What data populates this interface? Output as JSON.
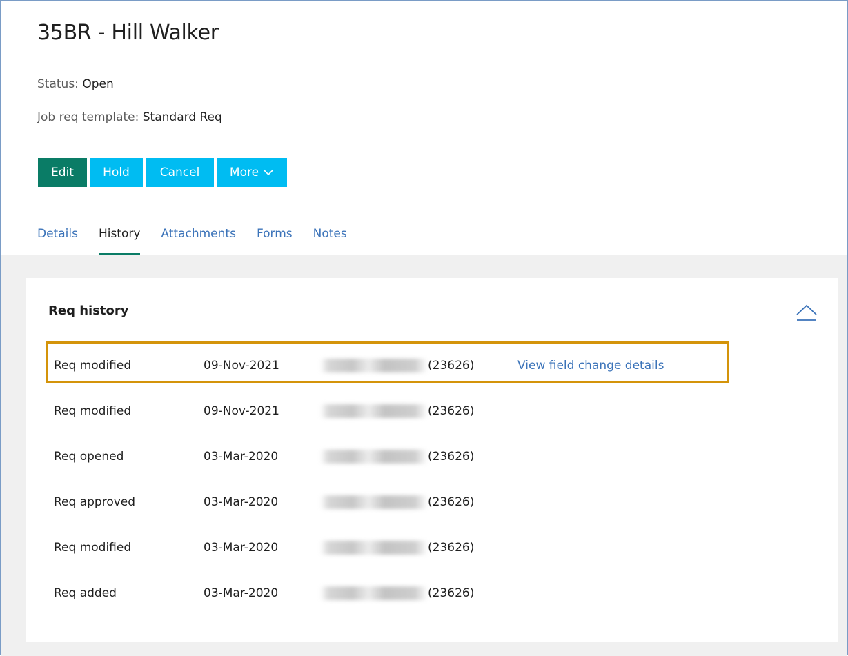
{
  "page": {
    "title": "35BR - Hill Walker",
    "status_label": "Status:",
    "status_value": "Open",
    "template_label": "Job req template:",
    "template_value": "Standard Req"
  },
  "toolbar": {
    "edit_label": "Edit",
    "hold_label": "Hold",
    "cancel_label": "Cancel",
    "more_label": "More"
  },
  "tabs": [
    {
      "label": "Details",
      "active": false
    },
    {
      "label": "History",
      "active": true
    },
    {
      "label": "Attachments",
      "active": false
    },
    {
      "label": "Forms",
      "active": false
    },
    {
      "label": "Notes",
      "active": false
    }
  ],
  "history": {
    "title": "Req history",
    "rows": [
      {
        "event": "Req modified",
        "date": "09-Nov-2021",
        "user_suffix": "(23626)",
        "link": "View field change details"
      },
      {
        "event": "Req modified",
        "date": "09-Nov-2021",
        "user_suffix": "(23626)",
        "link": ""
      },
      {
        "event": "Req opened",
        "date": "03-Mar-2020",
        "user_suffix": "(23626)",
        "link": ""
      },
      {
        "event": "Req approved",
        "date": "03-Mar-2020",
        "user_suffix": "(23626)",
        "link": ""
      },
      {
        "event": "Req modified",
        "date": "03-Mar-2020",
        "user_suffix": "(23626)",
        "link": ""
      },
      {
        "event": "Req added",
        "date": "03-Mar-2020",
        "user_suffix": "(23626)",
        "link": ""
      }
    ]
  },
  "colors": {
    "edit_button": "#0a7c66",
    "secondary_button": "#00bcf2",
    "link": "#3b73b9",
    "highlight_border": "#d4940a",
    "active_tab_underline": "#0a7c66"
  },
  "icons": {
    "more_dropdown": "chevron-down-icon",
    "collapse": "chevron-up-icon"
  }
}
